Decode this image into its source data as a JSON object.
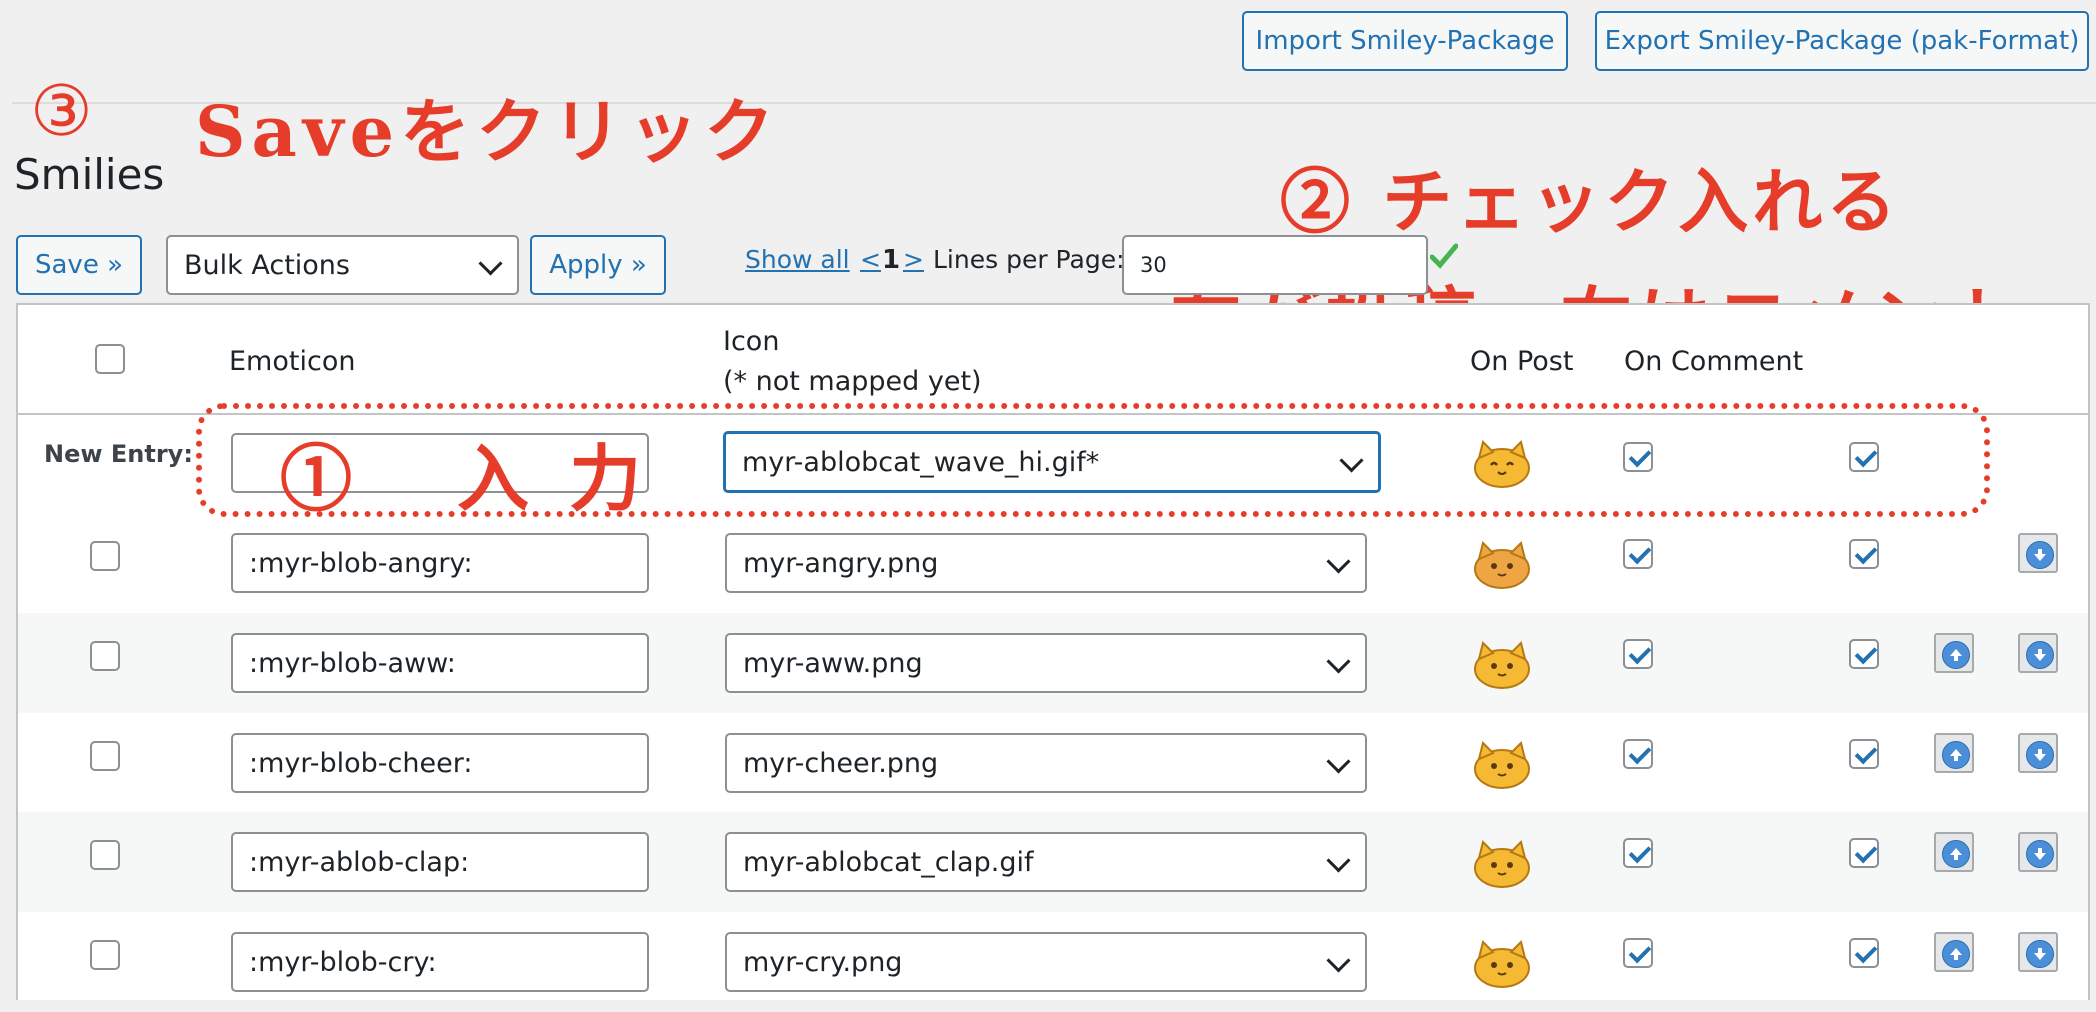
{
  "header": {
    "import_label": "Import Smiley-Package",
    "export_label": "Export Smiley-Package (pak-Format)"
  },
  "title": "Smilies",
  "annotations": {
    "step3_number": "③",
    "step3_text": "Saveをクリック",
    "step2_text": "② チェック入れる",
    "step2_sub": "左が投稿、右はコメント",
    "step1_text": "① 入力"
  },
  "toolbar": {
    "save_label": "Save »",
    "bulk_selected": "Bulk Actions",
    "apply_label": "Apply »",
    "show_all": "Show all",
    "prev": "<",
    "page": "1",
    "next": ">",
    "lines_label": "Lines per Page:",
    "lines_value": "30"
  },
  "table": {
    "headers": {
      "emoticon": "Emoticon",
      "icon": "Icon",
      "icon_note": "(* not mapped yet)",
      "on_post": "On Post",
      "on_comment": "On Comment"
    },
    "new_entry": {
      "label": "New Entry:",
      "emoticon_value": "",
      "icon_value": "myr-ablobcat_wave_hi.gif*",
      "on_post": true,
      "on_comment": true
    },
    "rows": [
      {
        "emoticon": ":myr-blob-angry:",
        "icon": "myr-angry.png",
        "on_post": true,
        "on_comment": true
      },
      {
        "emoticon": ":myr-blob-aww:",
        "icon": "myr-aww.png",
        "on_post": true,
        "on_comment": true
      },
      {
        "emoticon": ":myr-blob-cheer:",
        "icon": "myr-cheer.png",
        "on_post": true,
        "on_comment": true
      },
      {
        "emoticon": ":myr-ablob-clap:",
        "icon": "myr-ablobcat_clap.gif",
        "on_post": true,
        "on_comment": true
      },
      {
        "emoticon": ":myr-blob-cry:",
        "icon": "myr-cry.png",
        "on_post": true,
        "on_comment": true
      }
    ]
  },
  "colors": {
    "accent": "#2271b1",
    "annotation": "#e53d29"
  }
}
